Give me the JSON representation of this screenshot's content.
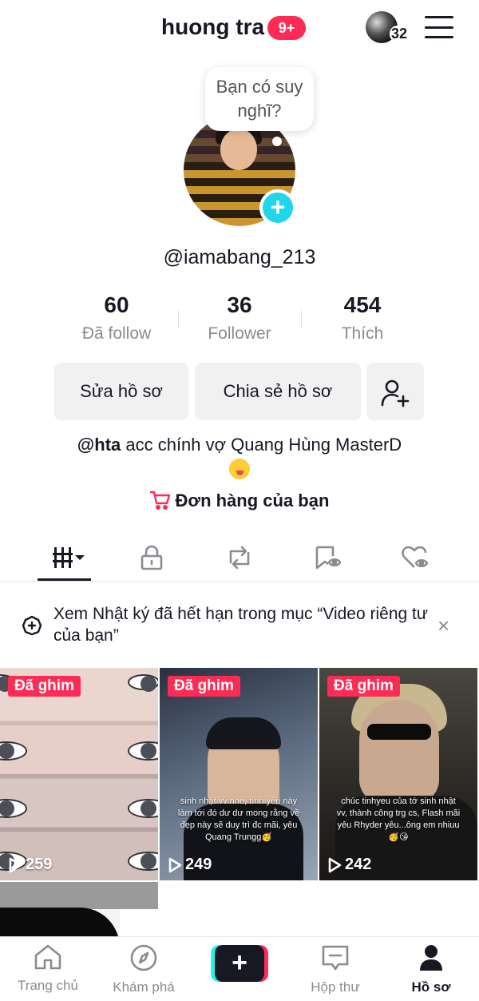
{
  "header": {
    "title": "huong tra",
    "notification_badge": "9+",
    "story_count": "32"
  },
  "profile": {
    "thought_bubble": "Bạn có suy nghĩ?",
    "handle": "@iamabang_213",
    "add_avatar_symbol": "+"
  },
  "stats": [
    {
      "value": "60",
      "label": "Đã follow"
    },
    {
      "value": "36",
      "label": "Follower"
    },
    {
      "value": "454",
      "label": "Thích"
    }
  ],
  "actions": {
    "edit_profile": "Sửa hồ sơ",
    "share_profile": "Chia sẻ hồ sơ"
  },
  "bio": {
    "mention": "@hta",
    "text": " acc chính vợ Quang Hùng MasterD"
  },
  "orders": {
    "label": "Đơn hàng của bạn"
  },
  "tabs": [
    "videos-grid-icon",
    "lock-icon",
    "repost-icon",
    "favorites-icon",
    "liked-icon"
  ],
  "notice": {
    "text": "Xem Nhật ký đã hết hạn trong mục “Video riêng tư của bạn”",
    "close": "×"
  },
  "videos": [
    {
      "pinned_label": "Đã ghim",
      "views": "259",
      "caption": ""
    },
    {
      "pinned_label": "Đã ghim",
      "views": "249",
      "caption": "sinh nhật vv nhe, tình yêu này làm tới đó dư dư mong rằng về đẹp này sẽ duy trì đc mãi, yêu Quang Trungg🥳"
    },
    {
      "pinned_label": "Đã ghim",
      "views": "242",
      "caption": "chúc tinhyeu của tớ sinh nhật vv, thành công trg cs, Flash mãi yêu Rhyder yêu...ông em nhiuu🥳😘"
    }
  ],
  "bottom_nav": [
    {
      "label": "Trang chủ",
      "icon": "home-icon"
    },
    {
      "label": "Khám phá",
      "icon": "compass-icon"
    },
    {
      "label": "",
      "icon": "plus-icon"
    },
    {
      "label": "Hộp thư",
      "icon": "inbox-icon"
    },
    {
      "label": "Hồ sơ",
      "icon": "profile-icon"
    }
  ],
  "colors": {
    "accent": "#fe2c55",
    "cyan": "#25f4ee",
    "text": "#161823",
    "muted": "#8a8b91",
    "button_bg": "#f1f1f2"
  }
}
